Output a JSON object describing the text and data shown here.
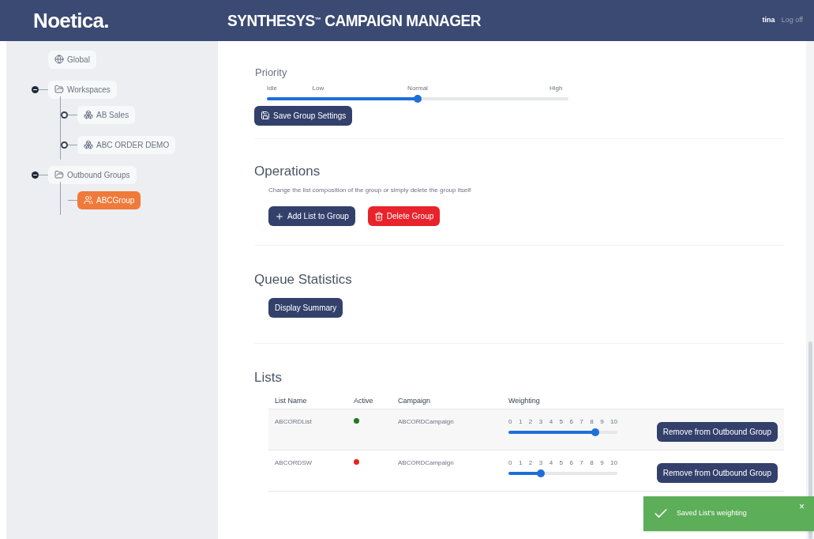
{
  "header": {
    "logo": "Noetica.",
    "title": "SYNTHESYS",
    "title_mark": "™",
    "title_rest": "CAMPAIGN MANAGER",
    "user": "tina",
    "logout": "Log off"
  },
  "tree": [
    {
      "label": "Global",
      "kind": "globe",
      "selected": false
    },
    {
      "label": "Workspaces",
      "kind": "folder",
      "expanded": true,
      "selected": false,
      "children": [
        {
          "label": "AB Sales",
          "kind": "workspace",
          "expanded": false,
          "selected": false
        },
        {
          "label": "ABC ORDER DEMO",
          "kind": "workspace",
          "expanded": false,
          "selected": false
        }
      ]
    },
    {
      "label": "Outbound Groups",
      "kind": "folder",
      "expanded": true,
      "selected": false,
      "children": [
        {
          "label": "ABCGroup",
          "kind": "group",
          "selected": true
        }
      ]
    }
  ],
  "priority": {
    "title": "Priority",
    "labels": [
      "Idle",
      "Low",
      "Normal",
      "High"
    ],
    "level": 0.5,
    "save_button": "Save Group Settings"
  },
  "operations": {
    "title": "Operations",
    "description": "Change the list composition of the group or simply delete the group itself",
    "add_button": "Add List to Group",
    "delete_button": "Delete Group"
  },
  "queue": {
    "title": "Queue Statistics",
    "button": "Display Summary"
  },
  "lists": {
    "title": "Lists",
    "columns": [
      "List Name",
      "Active",
      "Campaign",
      "Weighting"
    ],
    "rows": [
      {
        "name": "ABCORDList",
        "color": "#1f7a1f",
        "campaign": "ABCORDCampaign",
        "ticks": [
          "0",
          "1",
          "2",
          "3",
          "4",
          "5",
          "6",
          "7",
          "8",
          "9",
          "10"
        ],
        "level": 0.8,
        "button": "Remove from Outbound Group"
      },
      {
        "name": "ABCORDSW",
        "color": "#e8201f",
        "campaign": "ABCORDCampaign",
        "ticks": [
          "0",
          "1",
          "2",
          "3",
          "4",
          "5",
          "6",
          "7",
          "8",
          "9",
          "10"
        ],
        "level": 0.3,
        "button": "Remove from Outbound Group"
      }
    ]
  },
  "toast": {
    "message": "Saved List's weighting",
    "close": "×"
  }
}
